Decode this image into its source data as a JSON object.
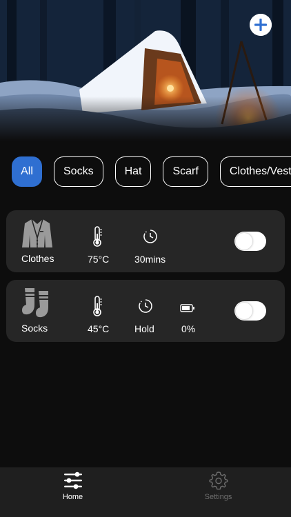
{
  "header": {
    "add_icon": "plus-icon",
    "accent": "#2f6fd1"
  },
  "filters": {
    "active": "All",
    "items": [
      "All",
      "Socks",
      "Hat",
      "Scarf",
      "Clothes/Vest"
    ]
  },
  "devices": [
    {
      "name": "Clothes",
      "icon": "jacket-icon",
      "temperature": "75°C",
      "timer": "30mins",
      "toggle_on": false
    },
    {
      "name": "Socks",
      "icon": "socks-icon",
      "temperature": "45°C",
      "timer": "Hold",
      "battery": "0%",
      "toggle_on": false
    }
  ],
  "bottom_nav": {
    "items": [
      {
        "label": "Home",
        "icon": "sliders-icon",
        "active": true
      },
      {
        "label": "Settings",
        "icon": "gear-icon",
        "active": false
      }
    ]
  }
}
